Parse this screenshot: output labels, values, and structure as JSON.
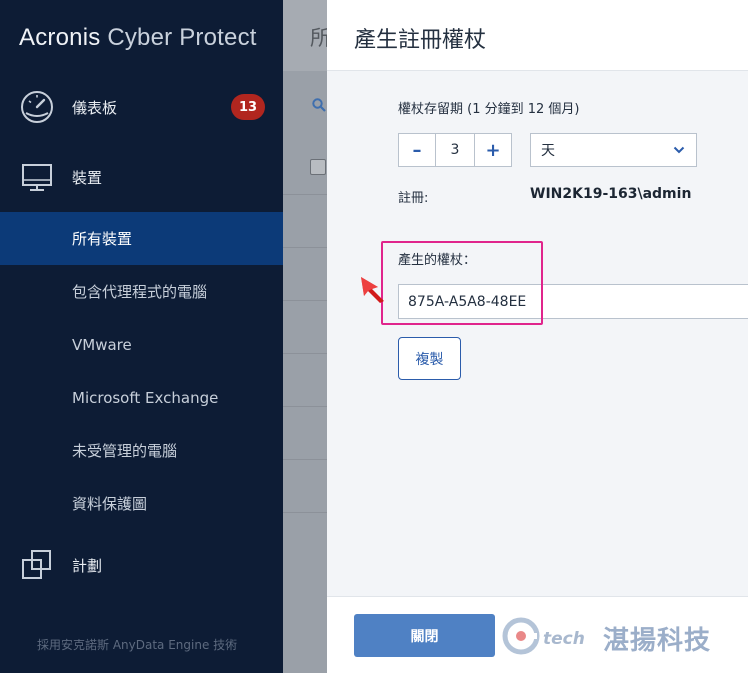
{
  "sidebar": {
    "logo": "Acronis Cyber Protect",
    "logo_bold": "Acronis",
    "logo_light": "Cyber Protect",
    "items": [
      {
        "label": "儀表板",
        "icon": "speedometer-icon",
        "badge": "13"
      },
      {
        "label": "裝置",
        "icon": "monitor-icon"
      },
      {
        "label": "所有裝置",
        "active": true
      },
      {
        "label": "包含代理程式的電腦"
      },
      {
        "label": "VMware"
      },
      {
        "label": "Microsoft Exchange"
      },
      {
        "label": "未受管理的電腦"
      },
      {
        "label": "資料保護圖"
      },
      {
        "label": "計劃",
        "icon": "plans-icon"
      }
    ],
    "footer": "採用安克諾斯 AnyData Engine 技術"
  },
  "background": {
    "title": "所"
  },
  "dialog": {
    "title": "產生註冊權杖",
    "lifetime_label": "權杖存留期 (1 分鐘到 12 個月)",
    "stepper": {
      "minus": "–",
      "value": "3",
      "plus": "+"
    },
    "unit_select": "天",
    "registration_label": "註冊:",
    "registration_value": "WIN2K19-163\\admin",
    "token_label": "產生的權杖：",
    "token_value": "875A-A5A8-48EE",
    "copy_button": "複製",
    "close_button": "關閉"
  },
  "watermark": {
    "tech": "tech",
    "text": "湛揚科技"
  },
  "colors": {
    "sidebar_bg": "#0d1c35",
    "active_item": "#0c3a78",
    "badge": "#b1261f",
    "accent": "#2b5cab",
    "primary_button": "#4f81c4",
    "highlight": "#e0258c",
    "arrow": "#d11a1a"
  }
}
